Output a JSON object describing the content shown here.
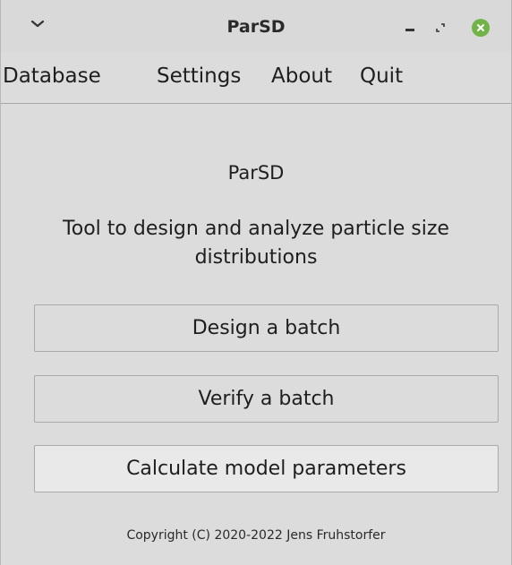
{
  "window": {
    "title": "ParSD",
    "controls": {
      "menu_icon": "chevron-down-icon",
      "minimize_icon": "minimize-icon",
      "maximize_icon": "maximize-icon",
      "close_icon": "close-icon"
    },
    "colors": {
      "background": "#dcdcdc",
      "close_button": "#72b347"
    }
  },
  "menubar": {
    "items": [
      {
        "label": "Database"
      },
      {
        "label": "Settings"
      },
      {
        "label": "About"
      },
      {
        "label": "Quit"
      }
    ]
  },
  "main": {
    "app_name": "ParSD",
    "description": "Tool to design and analyze particle size distributions",
    "buttons": {
      "design": "Design a batch",
      "verify": "Verify a batch",
      "calculate": "Calculate model parameters"
    },
    "copyright": "Copyright (C) 2020-2022 Jens Fruhstorfer"
  }
}
